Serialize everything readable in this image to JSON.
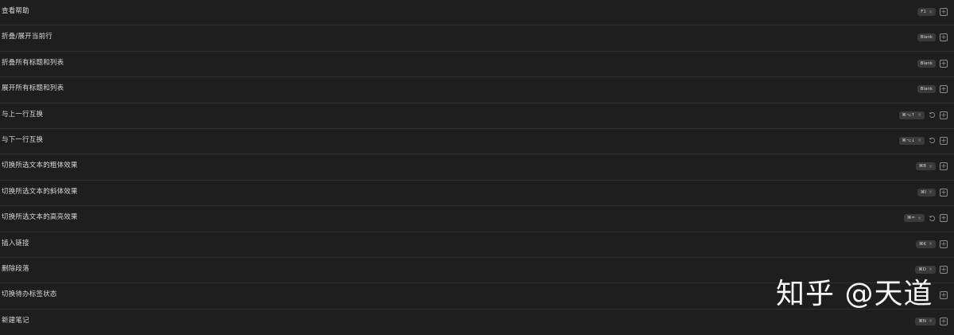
{
  "hotkeys": [
    {
      "label": "查看帮助",
      "keys": "F1",
      "custom": false
    },
    {
      "label": "折叠/展开当前行",
      "keys": "Blank",
      "custom": false
    },
    {
      "label": "折叠所有标题和列表",
      "keys": "Blank",
      "custom": false
    },
    {
      "label": "展开所有标题和列表",
      "keys": "Blank",
      "custom": false
    },
    {
      "label": "与上一行互换",
      "keys": "⌘⌥↑",
      "custom": true
    },
    {
      "label": "与下一行互换",
      "keys": "⌘⌥↓",
      "custom": true
    },
    {
      "label": "切换所选文本的粗体效果",
      "keys": "⌘B",
      "custom": false
    },
    {
      "label": "切换所选文本的斜体效果",
      "keys": "⌘I",
      "custom": false
    },
    {
      "label": "切换所选文本的高亮效果",
      "keys": "⌘=",
      "custom": true
    },
    {
      "label": "插入链接",
      "keys": "⌘K",
      "custom": false
    },
    {
      "label": "删除段落",
      "keys": "⌘D",
      "custom": false
    },
    {
      "label": "切换待办标签状态",
      "keys": "",
      "custom": false
    },
    {
      "label": "新建笔记",
      "keys": "⌘N",
      "custom": false
    }
  ],
  "watermark": "知乎 @天道",
  "icons": {
    "remove": "×",
    "add": "+",
    "reset": "reset-icon"
  }
}
